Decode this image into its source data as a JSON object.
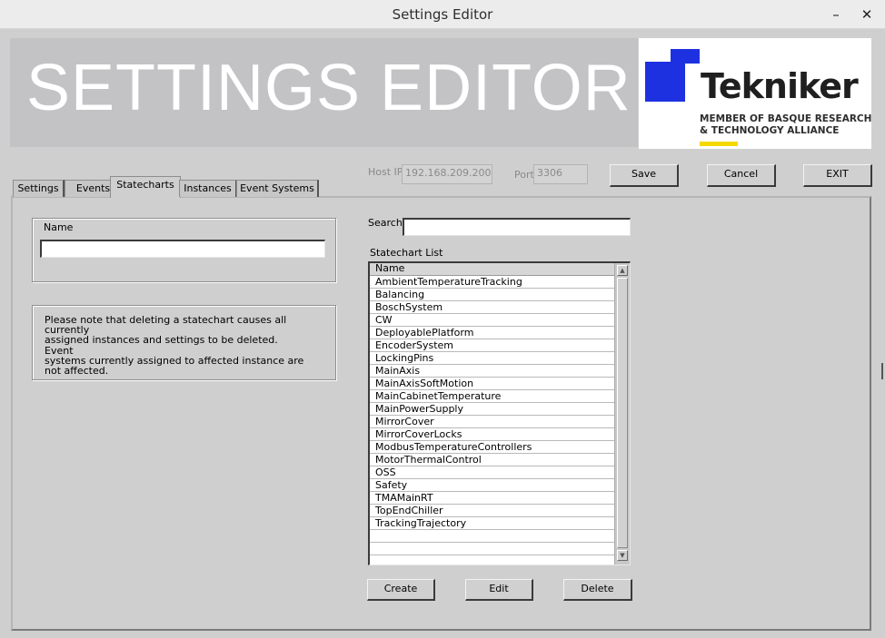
{
  "window": {
    "title": "Settings Editor",
    "minimize_glyph": "–",
    "close_glyph": "✕"
  },
  "banner": {
    "title": "SETTINGS EDITOR"
  },
  "logo": {
    "name": "Tekniker",
    "subline1": "MEMBER OF BASQUE RESEARCH",
    "subline2": "& TECHNOLOGY ALLIANCE",
    "colors": {
      "primary": "#1d31e0",
      "accent": "#f5d800"
    }
  },
  "tabs": [
    {
      "label": "Settings"
    },
    {
      "label": "Events"
    },
    {
      "label": "Statecharts",
      "active": true
    },
    {
      "label": "Instances"
    },
    {
      "label": "Event Systems"
    }
  ],
  "connection": {
    "host_label": "Host IP",
    "host_value": "192.168.209.200",
    "port_label": "Port",
    "port_value": "3306"
  },
  "toolbar": {
    "save_label": "Save",
    "cancel_label": "Cancel",
    "exit_label": "EXIT"
  },
  "form": {
    "name_label": "Name",
    "name_value": ""
  },
  "note": {
    "lines": [
      "Please note that deleting a statechart causes all currently",
      "assigned instances and settings to be deleted. Event",
      "systems currently assigned to affected instance are",
      "not affected."
    ]
  },
  "search": {
    "label": "Search:",
    "value": ""
  },
  "statechart_list": {
    "title": "Statechart List",
    "header": "Name",
    "items": [
      "AmbientTemperatureTracking",
      "Balancing",
      "BoschSystem",
      "CW",
      "DeployablePlatform",
      "EncoderSystem",
      "LockingPins",
      "MainAxis",
      "MainAxisSoftMotion",
      "MainCabinetTemperature",
      "MainPowerSupply",
      "MirrorCover",
      "MirrorCoverLocks",
      "ModbusTemperatureControllers",
      "MotorThermalControl",
      "OSS",
      "Safety",
      "TMAMainRT",
      "TopEndChiller",
      "TrackingTrajectory",
      "",
      "",
      ""
    ]
  },
  "actions": {
    "create_label": "Create",
    "edit_label": "Edit",
    "delete_label": "Delete"
  },
  "icons": {
    "scroll_up": "▲",
    "scroll_down": "▼"
  }
}
